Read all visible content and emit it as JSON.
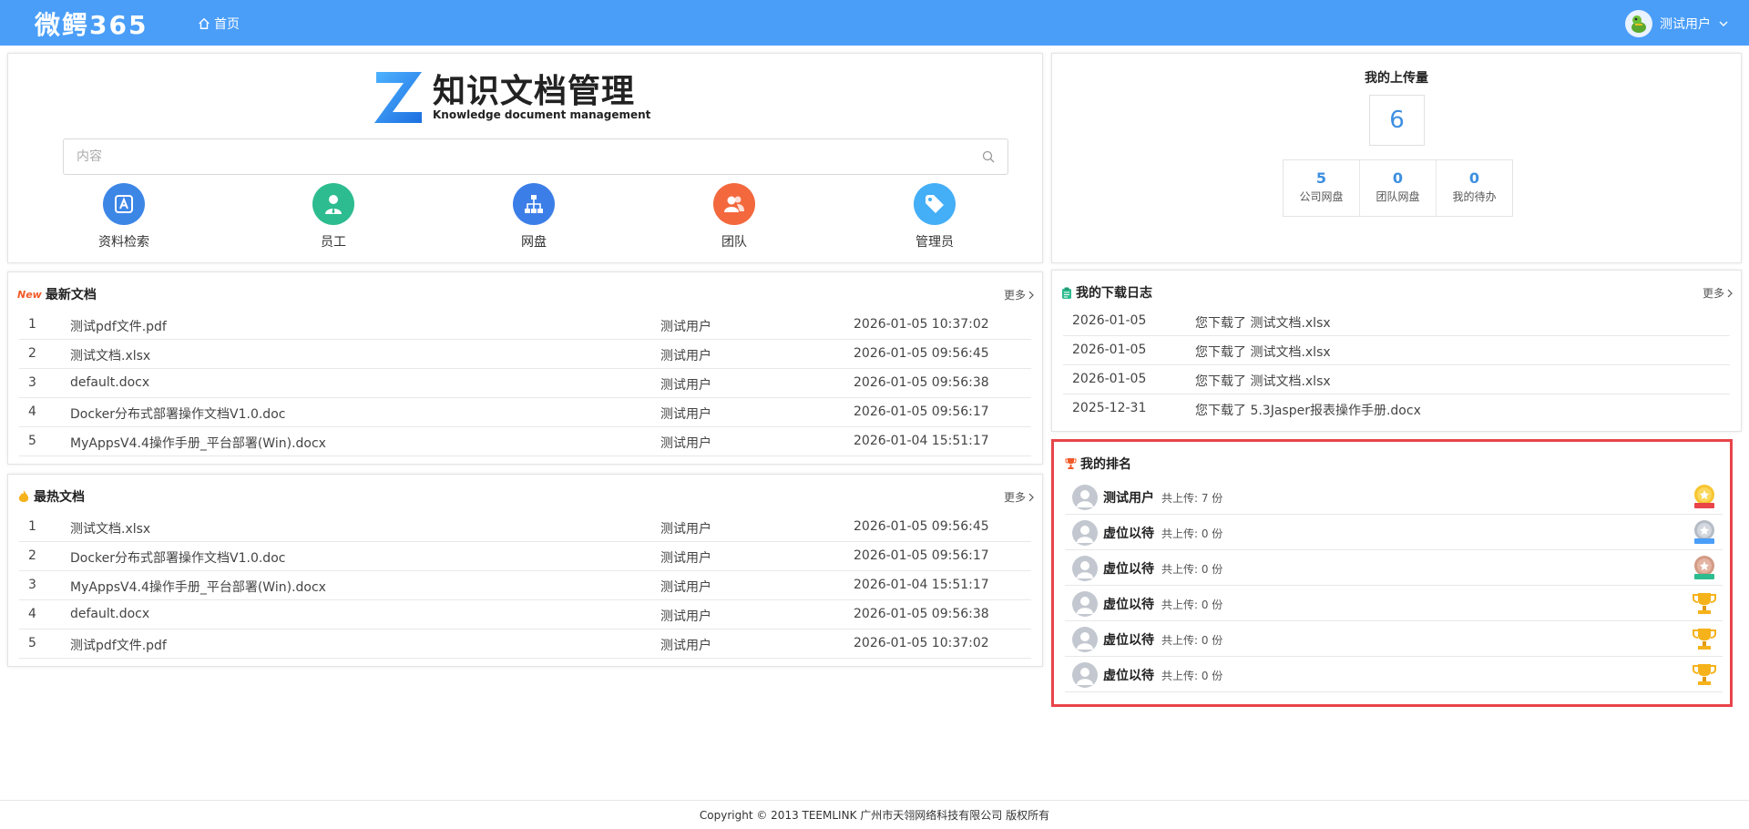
{
  "app": {
    "brand": "微鳄365",
    "nav_home": "首页",
    "user_name": "测试用户"
  },
  "search": {
    "logo_title": "知识文档管理",
    "logo_subtitle": "Knowledge document management",
    "placeholder": "内容",
    "value": "",
    "quick_links": [
      {
        "label": "资料检索",
        "icon": "search-doc-icon",
        "color": "#3c86e6"
      },
      {
        "label": "员工",
        "icon": "employee-icon",
        "color": "#2dbc8f"
      },
      {
        "label": "网盘",
        "icon": "network-disk-icon",
        "color": "#3c7ee8"
      },
      {
        "label": "团队",
        "icon": "team-icon",
        "color": "#f3683d"
      },
      {
        "label": "管理员",
        "icon": "admin-tag-icon",
        "color": "#44aef6"
      }
    ]
  },
  "upload": {
    "title": "我的上传量",
    "total": "6",
    "stats": [
      {
        "value": "5",
        "label": "公司网盘"
      },
      {
        "value": "0",
        "label": "团队网盘"
      },
      {
        "value": "0",
        "label": "我的待办"
      }
    ]
  },
  "latest_docs": {
    "title": "最新文档",
    "badge": "New",
    "more": "更多",
    "rows": [
      {
        "index": "1",
        "name": "测试pdf文件.pdf",
        "user": "测试用户",
        "time": "2026-01-05 10:37:02"
      },
      {
        "index": "2",
        "name": "测试文档.xlsx",
        "user": "测试用户",
        "time": "2026-01-05 09:56:45"
      },
      {
        "index": "3",
        "name": "default.docx",
        "user": "测试用户",
        "time": "2026-01-05 09:56:38"
      },
      {
        "index": "4",
        "name": "Docker分布式部署操作文档V1.0.doc",
        "user": "测试用户",
        "time": "2026-01-05 09:56:17"
      },
      {
        "index": "5",
        "name": "MyAppsV4.4操作手册_平台部署(Win).docx",
        "user": "测试用户",
        "time": "2026-01-04 15:51:17"
      }
    ]
  },
  "hot_docs": {
    "title": "最热文档",
    "more": "更多",
    "rows": [
      {
        "index": "1",
        "name": "测试文档.xlsx",
        "user": "测试用户",
        "time": "2026-01-05 09:56:45"
      },
      {
        "index": "2",
        "name": "Docker分布式部署操作文档V1.0.doc",
        "user": "测试用户",
        "time": "2026-01-05 09:56:17"
      },
      {
        "index": "3",
        "name": "MyAppsV4.4操作手册_平台部署(Win).docx",
        "user": "测试用户",
        "time": "2026-01-04 15:51:17"
      },
      {
        "index": "4",
        "name": "default.docx",
        "user": "测试用户",
        "time": "2026-01-05 09:56:38"
      },
      {
        "index": "5",
        "name": "测试pdf文件.pdf",
        "user": "测试用户",
        "time": "2026-01-05 10:37:02"
      }
    ]
  },
  "download_log": {
    "title": "我的下载日志",
    "more": "更多",
    "rows": [
      {
        "date": "2026-01-05",
        "text": "您下载了 测试文档.xlsx"
      },
      {
        "date": "2026-01-05",
        "text": "您下载了 测试文档.xlsx"
      },
      {
        "date": "2026-01-05",
        "text": "您下载了 测试文档.xlsx"
      },
      {
        "date": "2025-12-31",
        "text": "您下载了 5.3Jasper报表操作手册.docx"
      }
    ]
  },
  "ranking": {
    "title": "我的排名",
    "highlight_color": "#e8444a",
    "rows": [
      {
        "name": "测试用户",
        "count": "共上传: 7 份",
        "badge": "gold-medal-icon"
      },
      {
        "name": "虚位以待",
        "count": "共上传: 0 份",
        "badge": "silver-medal-icon"
      },
      {
        "name": "虚位以待",
        "count": "共上传: 0 份",
        "badge": "bronze-medal-icon"
      },
      {
        "name": "虚位以待",
        "count": "共上传: 0 份",
        "badge": "trophy-icon"
      },
      {
        "name": "虚位以待",
        "count": "共上传: 0 份",
        "badge": "trophy-icon"
      },
      {
        "name": "虚位以待",
        "count": "共上传: 0 份",
        "badge": "trophy-icon"
      }
    ]
  },
  "footer": {
    "text": "Copyright © 2013 TEEMLINK 广州市天翎网络科技有限公司 版权所有"
  }
}
